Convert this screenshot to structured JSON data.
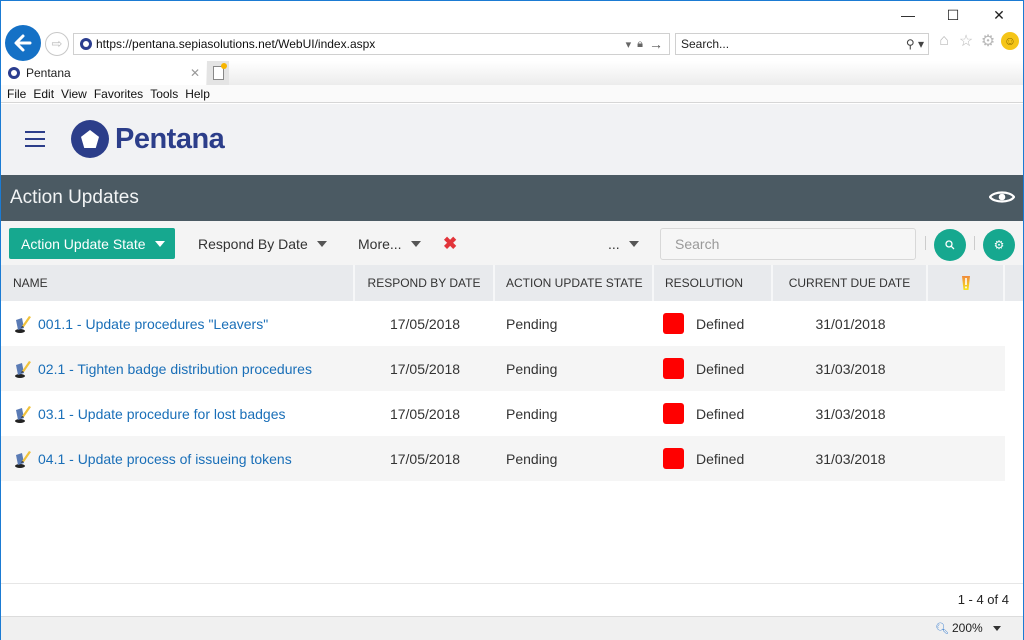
{
  "browser": {
    "window_controls": {
      "minimize": "—",
      "maximize": "☐",
      "close": "✕"
    },
    "address_url": "https://pentana.sepiasolutions.net/WebUI/index.aspx",
    "search_placeholder": "Search...",
    "tab_title": "Pentana",
    "menu": [
      "File",
      "Edit",
      "View",
      "Favorites",
      "Tools",
      "Help"
    ],
    "zoom_level": "200%"
  },
  "app": {
    "brand": "Pentana",
    "brand_color": "#2c3e8a",
    "accent_color": "#16a88f",
    "page_title": "Action Updates"
  },
  "filters": {
    "primary": "Action Update State",
    "respond_by": "Respond By Date",
    "more": "More...",
    "dots": "...",
    "search_placeholder": "Search"
  },
  "table": {
    "columns": [
      "NAME",
      "RESPOND BY DATE",
      "ACTION UPDATE STATE",
      "RESOLUTION",
      "CURRENT DUE DATE"
    ],
    "rows": [
      {
        "name": "001.1 - Update procedures \"Leavers\"",
        "respond_by": "17/05/2018",
        "state": "Pending",
        "resolution": "Defined",
        "resolution_color": "#ff0000",
        "due": "31/01/2018"
      },
      {
        "name": "02.1 - Tighten badge distribution procedures",
        "respond_by": "17/05/2018",
        "state": "Pending",
        "resolution": "Defined",
        "resolution_color": "#ff0000",
        "due": "31/03/2018"
      },
      {
        "name": "03.1 - Update procedure for lost badges",
        "respond_by": "17/05/2018",
        "state": "Pending",
        "resolution": "Defined",
        "resolution_color": "#ff0000",
        "due": "31/03/2018"
      },
      {
        "name": "04.1 - Update process of issueing tokens",
        "respond_by": "17/05/2018",
        "state": "Pending",
        "resolution": "Defined",
        "resolution_color": "#ff0000",
        "due": "31/03/2018"
      }
    ]
  },
  "pager": {
    "text": "1 - 4 of 4"
  }
}
